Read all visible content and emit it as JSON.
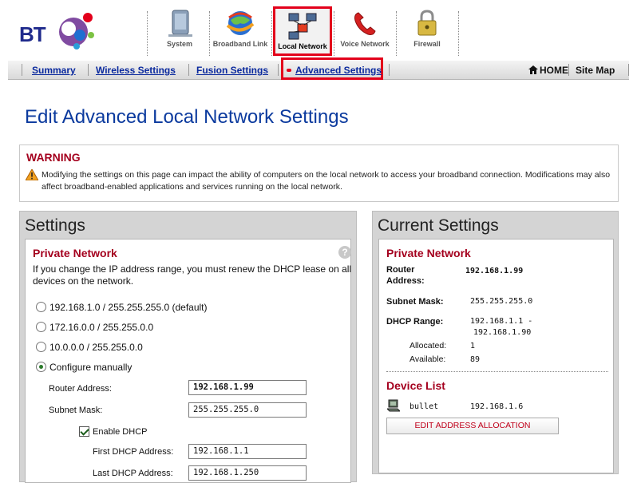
{
  "brand": {
    "logo_text": "BT",
    "colors": {
      "purple": "#6a2c91",
      "blue": "#1f2a8c",
      "red": "#e3001b"
    }
  },
  "topnav": [
    {
      "label": "System",
      "icon": "system-icon"
    },
    {
      "label": "Broadband Link",
      "icon": "globe-icon"
    },
    {
      "label": "Local Network",
      "icon": "local-network-icon",
      "active": true
    },
    {
      "label": "Voice Network",
      "icon": "telephone-icon"
    },
    {
      "label": "Firewall",
      "icon": "padlock-icon"
    }
  ],
  "subnav": {
    "summary": "Summary",
    "wireless": "Wireless Settings",
    "fusion": "Fusion Settings",
    "advanced": "Advanced Settings",
    "home": "HOME",
    "sitemap": "Site Map"
  },
  "page_title": "Edit Advanced Local Network Settings",
  "warning": {
    "title": "WARNING",
    "text": "Modifying the settings on this page can impact the ability of computers on the local network to access your broadband connection. Modifications may also affect broadband-enabled applications and services running on the local network."
  },
  "settings": {
    "title": "Settings",
    "section_title": "Private Network",
    "description": "If you change the IP address range, you must renew the DHCP lease on all devices on the network.",
    "options": [
      "192.168.1.0 / 255.255.255.0 (default)",
      "172.16.0.0 / 255.255.0.0",
      "10.0.0.0 / 255.255.0.0",
      "Configure manually"
    ],
    "router_address_label": "Router Address:",
    "router_address": "192.168.1.99",
    "subnet_mask_label": "Subnet Mask:",
    "subnet_mask": "255.255.255.0",
    "enable_dhcp_label": "Enable DHCP",
    "first_dhcp_label": "First DHCP Address:",
    "first_dhcp": "192.168.1.1",
    "last_dhcp_label": "Last DHCP Address:",
    "last_dhcp": "192.168.1.250"
  },
  "current": {
    "title": "Current Settings",
    "section_title": "Private Network",
    "router_address_label": "Router Address:",
    "router_address": "192.168.1.99",
    "subnet_mask_label": "Subnet Mask:",
    "subnet_mask": "255.255.255.0",
    "dhcp_range_label": "DHCP Range:",
    "dhcp_range_start": "192.168.1.1 -",
    "dhcp_range_end": "192.168.1.90",
    "allocated_label": "Allocated:",
    "allocated": "1",
    "available_label": "Available:",
    "available": "89",
    "device_list_title": "Device List",
    "device_name": "bullet",
    "device_ip": "192.168.1.6",
    "edit_button": "EDIT ADDRESS ALLOCATION"
  }
}
